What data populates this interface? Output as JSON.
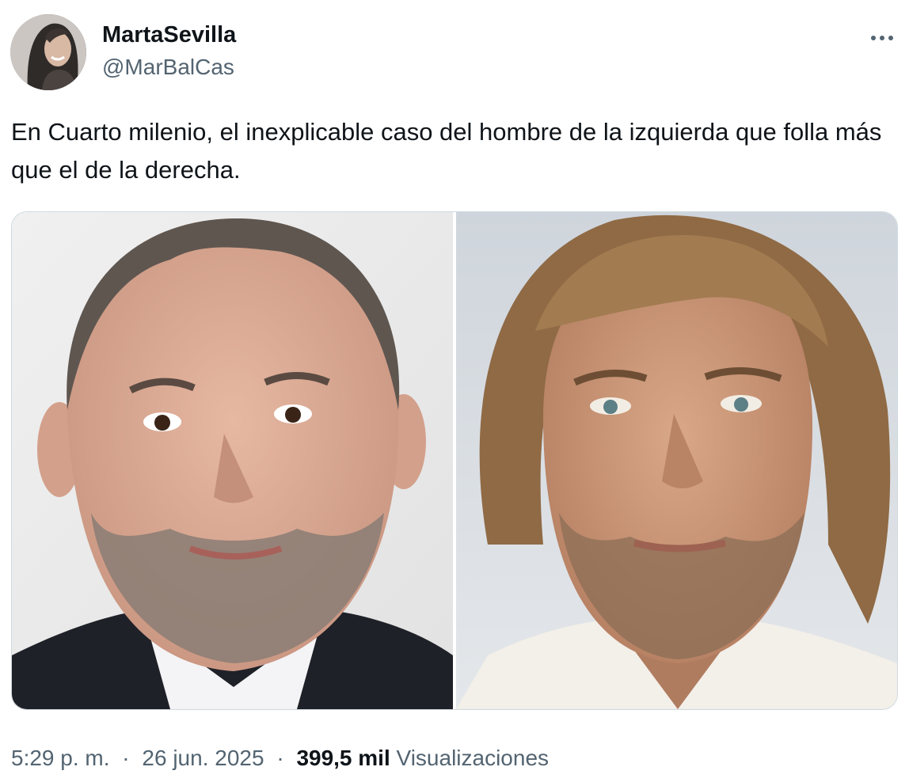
{
  "author": {
    "display_name": "MartaSevilla",
    "handle": "@MarBalCas"
  },
  "more_icon": "more-horizontal-icon",
  "tweet": {
    "text": "En Cuarto milenio, el inexplicable caso del hombre de la izquierda que folla más que el de la derecha."
  },
  "media": {
    "count": 2
  },
  "meta": {
    "time": "5:29 p. m.",
    "separator": "·",
    "date": "26 jun. 2025",
    "views_count": "399,5 mil",
    "views_label": "Visualizaciones"
  },
  "colors": {
    "text_primary": "#0f1419",
    "text_secondary": "#536471",
    "border": "#cfd9de"
  }
}
